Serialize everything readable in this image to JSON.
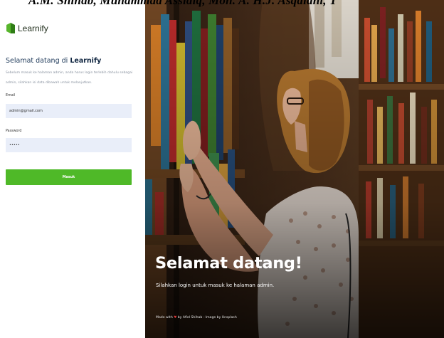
{
  "caption": "A.M. Shihab, Muhammad Assidiq, Moh. A. H.J. Asqalani, T",
  "brand": {
    "name": "Learnify",
    "logo_icon": "book-leaf-icon",
    "accent": "#4fb928"
  },
  "login": {
    "welcome_prefix": "Selamat datang di ",
    "welcome_brand": "Learnify",
    "description": "Sebelum masuk ke halaman admin, anda harus login terlebih dahulu sebagai admin, silahkan isi data dibawah untuk melanjutkan.",
    "email_label": "Email",
    "email_value": "admin@gmail.com",
    "password_label": "Password",
    "password_value": "admin",
    "submit_label": "Masuk"
  },
  "hero": {
    "title": "Selamat datang!",
    "subtitle": "Silahkan login untuk masuk ke halaman admin.",
    "credit_prefix": "Made with",
    "credit_heart": "♥",
    "credit_suffix": "by Afiel Shihab - Image by Unsplash"
  }
}
